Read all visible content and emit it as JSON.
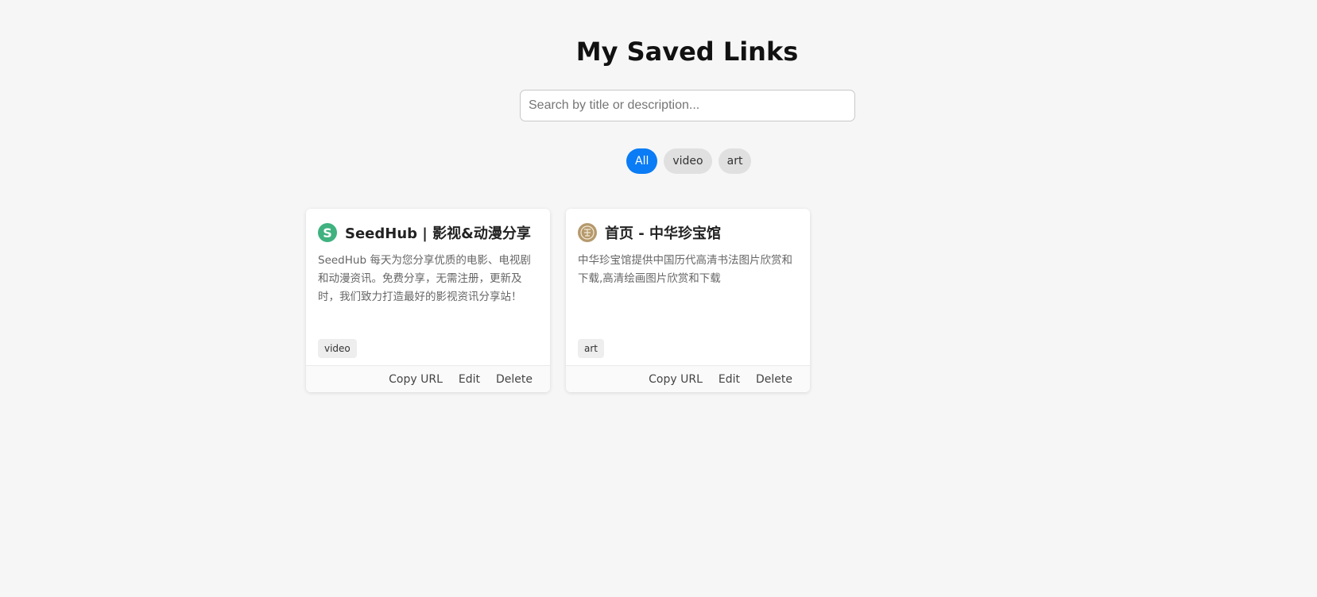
{
  "page": {
    "title": "My Saved Links"
  },
  "search": {
    "placeholder": "Search by title or description...",
    "value": ""
  },
  "filters": [
    {
      "label": "All",
      "active": true
    },
    {
      "label": "video",
      "active": false
    },
    {
      "label": "art",
      "active": false
    }
  ],
  "cards": [
    {
      "favicon_letter": "S",
      "favicon_color": "#3fb27f",
      "title": "SeedHub | 影视&动漫分享",
      "description": "SeedHub 每天为您分享优质的电影、电视剧和动漫资讯。免费分享，无需注册，更新及时，我们致力打造最好的影视资讯分享站！",
      "tag": "video",
      "actions": {
        "copy": "Copy URL",
        "edit": "Edit",
        "delete": "Delete"
      }
    },
    {
      "favicon_letter": "",
      "favicon_icon": "seal-icon",
      "favicon_color": "#b59a6e",
      "title": "首页 - 中华珍宝馆",
      "description": "中华珍宝馆提供中国历代高清书法图片欣赏和下载,高清绘画图片欣赏和下载",
      "tag": "art",
      "actions": {
        "copy": "Copy URL",
        "edit": "Edit",
        "delete": "Delete"
      }
    }
  ]
}
